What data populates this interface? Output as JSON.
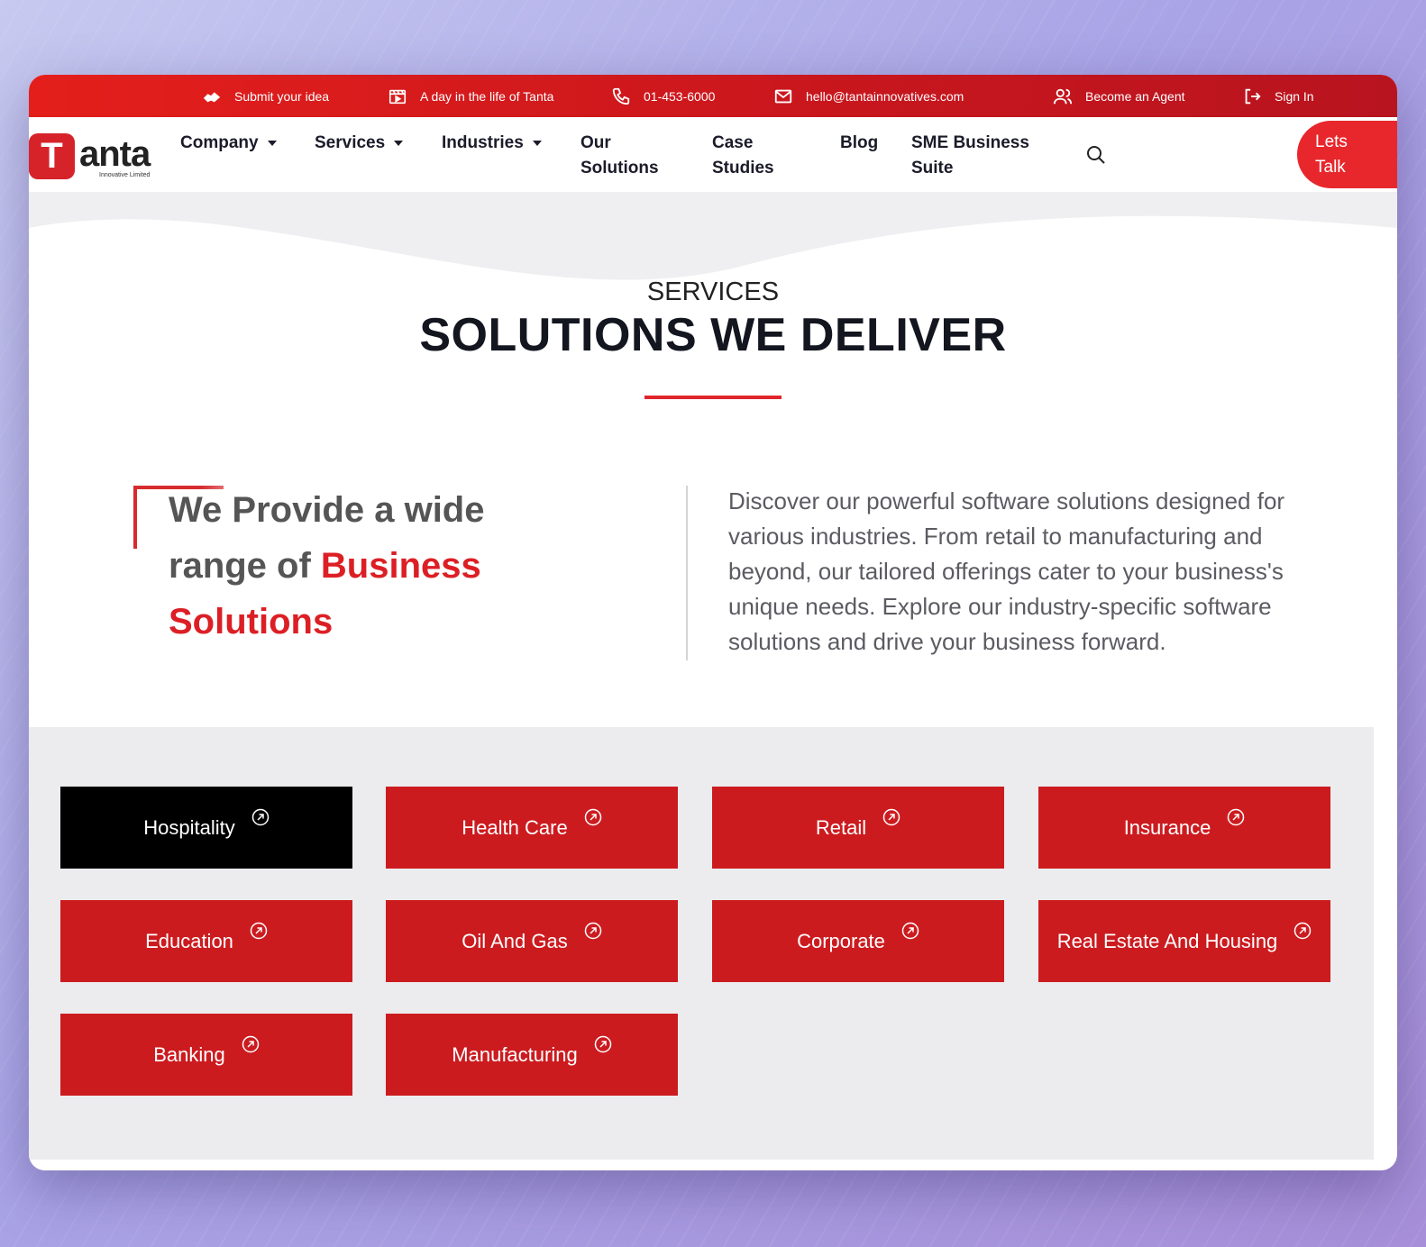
{
  "topbar": {
    "items": [
      {
        "label": "Submit your idea",
        "icon": "handshake-icon"
      },
      {
        "label": "A day in the life of Tanta",
        "icon": "clapperboard-icon"
      },
      {
        "label": "01-453-6000",
        "icon": "phone-icon"
      },
      {
        "label": "hello@tantainnovatives.com",
        "icon": "mail-icon"
      },
      {
        "label": "Become an Agent",
        "icon": "users-icon"
      },
      {
        "label": "Sign In",
        "icon": "sign-in-icon"
      }
    ]
  },
  "logo": {
    "letter": "T",
    "word": "anta",
    "sub": "Innovative Limited"
  },
  "nav": {
    "company": "Company",
    "services": "Services",
    "industries": "Industries",
    "solutions_1": "Our",
    "solutions_2": "Solutions",
    "case_1": "Case",
    "case_2": "Studies",
    "blog": "Blog",
    "sme_1": "SME Business",
    "sme_2": "Suite",
    "cta_1": "Lets",
    "cta_2": "Talk"
  },
  "hero": {
    "eyebrow": "SERVICES",
    "headline": "SOLUTIONS WE DELIVER",
    "tagline_plain": "We Provide a wide range of ",
    "tagline_highlight": "Business Solutions",
    "blurb": "Discover our powerful software solutions designed for various industries. From retail to manufacturing and beyond, our tailored offerings cater to your business's unique needs. Explore our industry-specific software solutions and drive your business forward."
  },
  "industries": [
    {
      "label": "Hospitality",
      "active": true
    },
    {
      "label": "Health Care",
      "active": false
    },
    {
      "label": "Retail",
      "active": false
    },
    {
      "label": "Insurance",
      "active": false
    },
    {
      "label": "Education",
      "active": false
    },
    {
      "label": "Oil And Gas",
      "active": false
    },
    {
      "label": "Corporate",
      "active": false
    },
    {
      "label": "Real Estate And Housing",
      "active": false
    },
    {
      "label": "Banking",
      "active": false
    },
    {
      "label": "Manufacturing",
      "active": false
    }
  ],
  "colors": {
    "brand_red": "#cc1b1f",
    "active_tile": "#000000"
  }
}
